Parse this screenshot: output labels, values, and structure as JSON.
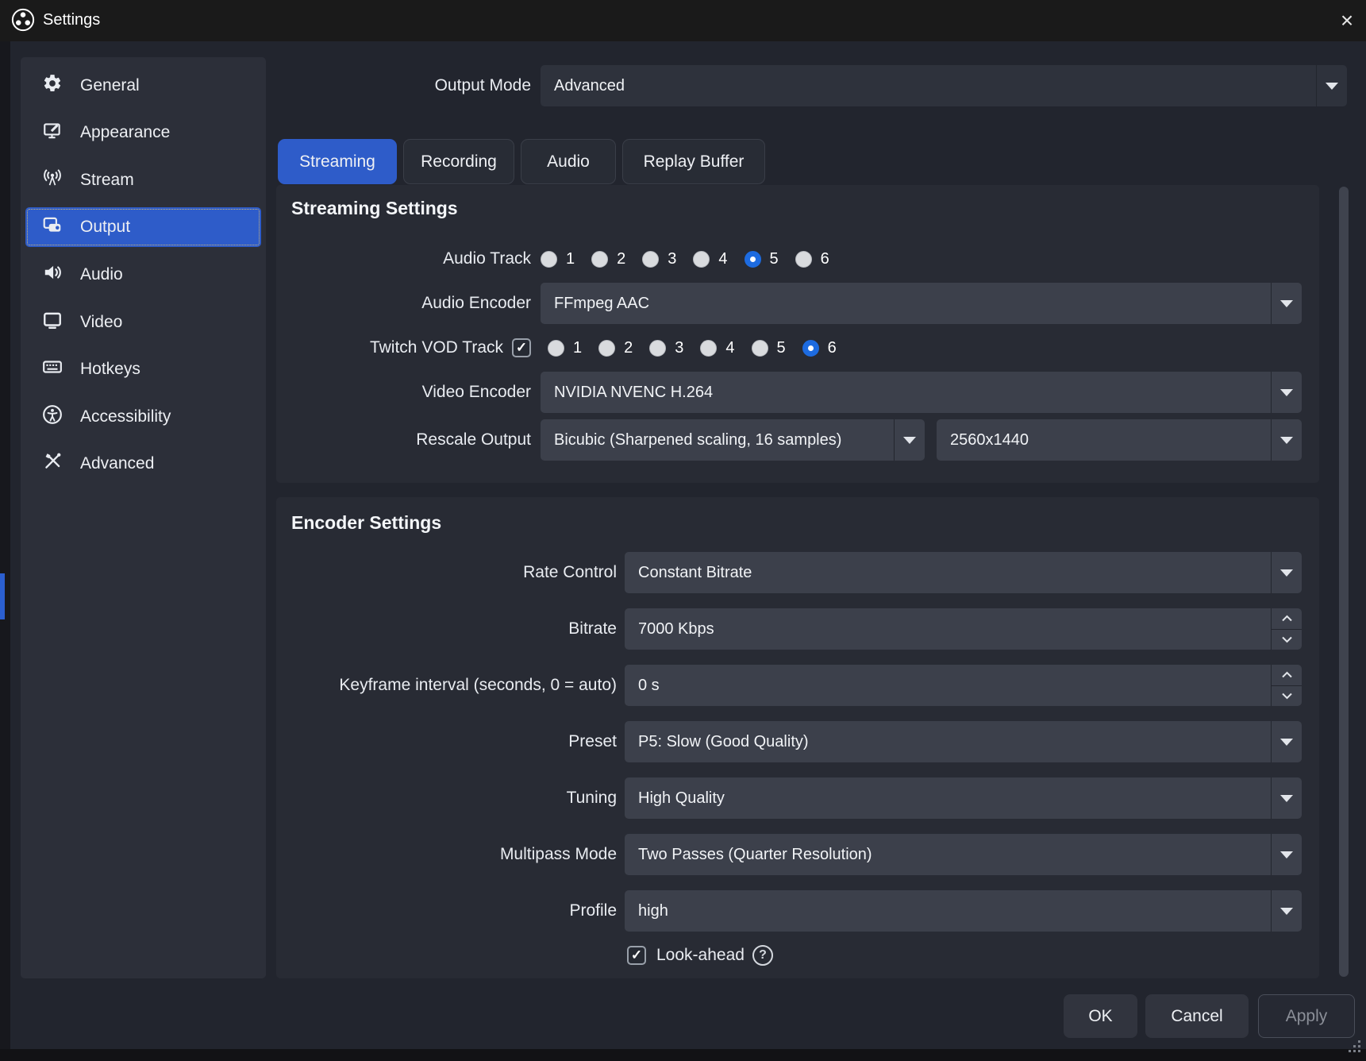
{
  "window": {
    "title": "Settings",
    "close": "×"
  },
  "sidebar": {
    "selected": "Output",
    "items": [
      {
        "label": "General",
        "icon": "gear-icon"
      },
      {
        "label": "Appearance",
        "icon": "appearance-icon"
      },
      {
        "label": "Stream",
        "icon": "antenna-icon"
      },
      {
        "label": "Output",
        "icon": "camera-icon"
      },
      {
        "label": "Audio",
        "icon": "speaker-icon"
      },
      {
        "label": "Video",
        "icon": "monitor-icon"
      },
      {
        "label": "Hotkeys",
        "icon": "keyboard-icon"
      },
      {
        "label": "Accessibility",
        "icon": "accessibility-icon"
      },
      {
        "label": "Advanced",
        "icon": "tools-icon"
      }
    ]
  },
  "output_mode": {
    "label": "Output Mode",
    "value": "Advanced"
  },
  "tabs": {
    "active": "Streaming",
    "items": [
      {
        "label": "Streaming"
      },
      {
        "label": "Recording"
      },
      {
        "label": "Audio"
      },
      {
        "label": "Replay Buffer"
      }
    ]
  },
  "streaming": {
    "heading": "Streaming Settings",
    "audio_track": {
      "label": "Audio Track",
      "options": [
        "1",
        "2",
        "3",
        "4",
        "5",
        "6"
      ],
      "selected": "5"
    },
    "audio_encoder": {
      "label": "Audio Encoder",
      "value": "FFmpeg AAC"
    },
    "twitch_vod": {
      "label": "Twitch VOD Track",
      "checked": true,
      "options": [
        "1",
        "2",
        "3",
        "4",
        "5",
        "6"
      ],
      "selected": "6"
    },
    "video_encoder": {
      "label": "Video Encoder",
      "value": "NVIDIA NVENC H.264"
    },
    "rescale": {
      "label": "Rescale Output",
      "filter": "Bicubic (Sharpened scaling, 16 samples)",
      "resolution": "2560x1440"
    }
  },
  "encoder": {
    "heading": "Encoder Settings",
    "rate_control": {
      "label": "Rate Control",
      "value": "Constant Bitrate"
    },
    "bitrate": {
      "label": "Bitrate",
      "value": "7000 Kbps"
    },
    "keyframe": {
      "label": "Keyframe interval (seconds, 0 = auto)",
      "value": "0 s"
    },
    "preset": {
      "label": "Preset",
      "value": "P5: Slow (Good Quality)"
    },
    "tuning": {
      "label": "Tuning",
      "value": "High Quality"
    },
    "multipass": {
      "label": "Multipass Mode",
      "value": "Two Passes (Quarter Resolution)"
    },
    "profile": {
      "label": "Profile",
      "value": "high"
    },
    "look_ahead": {
      "label": "Look-ahead",
      "checked": true,
      "help": "?"
    }
  },
  "footer": {
    "ok": "OK",
    "cancel": "Cancel",
    "apply": "Apply"
  },
  "colors": {
    "accent": "#2e5cc9",
    "radio_selected": "#1d6be0",
    "field_bg": "#3c404b"
  }
}
